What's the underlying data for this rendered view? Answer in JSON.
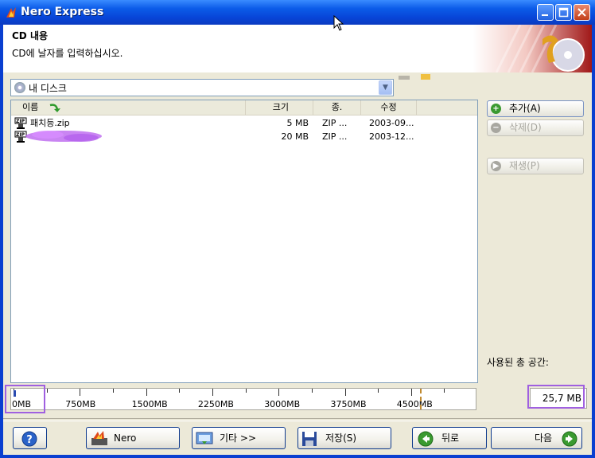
{
  "window": {
    "title": "Nero Express"
  },
  "header": {
    "title": "CD 내용",
    "subtitle": "CD에 날자를 입력하십시오."
  },
  "disc_selector": {
    "value": "내 디스크"
  },
  "file_list": {
    "columns": [
      "이름",
      "크기",
      "종.",
      "수정"
    ],
    "rows": [
      {
        "name": "패치등.zip",
        "size": "5 MB",
        "type": "ZIP ...",
        "modified": "2003-09..."
      },
      {
        "name": "",
        "size": "20 MB",
        "type": "ZIP ...",
        "modified": "2003-12..."
      }
    ]
  },
  "side_buttons": {
    "add": "추가(A)",
    "delete": "삭제(D)",
    "play": "재생(P)"
  },
  "usage": {
    "label": "사용된 총 공간:",
    "total": "25,7 MB",
    "used_fraction": 0.005
  },
  "ruler": {
    "labels": [
      "0MB",
      "750MB",
      "1500MB",
      "2250MB",
      "3000MB",
      "3750MB",
      "4500MB"
    ]
  },
  "footer": {
    "help": "?",
    "nero": "Nero",
    "more": "기타 >>",
    "save": "저장(S)",
    "back": "뒤로",
    "next": "다음"
  },
  "colors": {
    "title_bar": "#0a3fd0",
    "highlight": "#a060e0",
    "accent_green": "#2f9a2c"
  }
}
